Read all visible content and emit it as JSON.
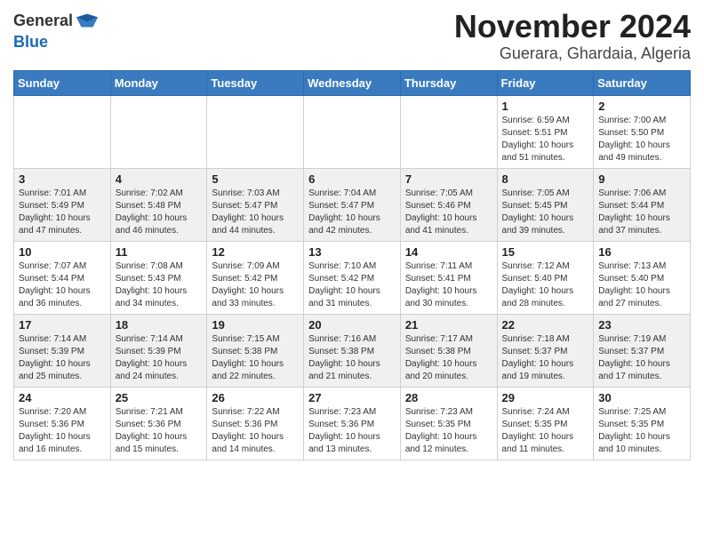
{
  "header": {
    "logo_line1": "General",
    "logo_line2": "Blue",
    "title": "November 2024",
    "subtitle": "Guerara, Ghardaia, Algeria"
  },
  "days_of_week": [
    "Sunday",
    "Monday",
    "Tuesday",
    "Wednesday",
    "Thursday",
    "Friday",
    "Saturday"
  ],
  "weeks": [
    [
      {
        "day": "",
        "info": ""
      },
      {
        "day": "",
        "info": ""
      },
      {
        "day": "",
        "info": ""
      },
      {
        "day": "",
        "info": ""
      },
      {
        "day": "",
        "info": ""
      },
      {
        "day": "1",
        "info": "Sunrise: 6:59 AM\nSunset: 5:51 PM\nDaylight: 10 hours\nand 51 minutes."
      },
      {
        "day": "2",
        "info": "Sunrise: 7:00 AM\nSunset: 5:50 PM\nDaylight: 10 hours\nand 49 minutes."
      }
    ],
    [
      {
        "day": "3",
        "info": "Sunrise: 7:01 AM\nSunset: 5:49 PM\nDaylight: 10 hours\nand 47 minutes."
      },
      {
        "day": "4",
        "info": "Sunrise: 7:02 AM\nSunset: 5:48 PM\nDaylight: 10 hours\nand 46 minutes."
      },
      {
        "day": "5",
        "info": "Sunrise: 7:03 AM\nSunset: 5:47 PM\nDaylight: 10 hours\nand 44 minutes."
      },
      {
        "day": "6",
        "info": "Sunrise: 7:04 AM\nSunset: 5:47 PM\nDaylight: 10 hours\nand 42 minutes."
      },
      {
        "day": "7",
        "info": "Sunrise: 7:05 AM\nSunset: 5:46 PM\nDaylight: 10 hours\nand 41 minutes."
      },
      {
        "day": "8",
        "info": "Sunrise: 7:05 AM\nSunset: 5:45 PM\nDaylight: 10 hours\nand 39 minutes."
      },
      {
        "day": "9",
        "info": "Sunrise: 7:06 AM\nSunset: 5:44 PM\nDaylight: 10 hours\nand 37 minutes."
      }
    ],
    [
      {
        "day": "10",
        "info": "Sunrise: 7:07 AM\nSunset: 5:44 PM\nDaylight: 10 hours\nand 36 minutes."
      },
      {
        "day": "11",
        "info": "Sunrise: 7:08 AM\nSunset: 5:43 PM\nDaylight: 10 hours\nand 34 minutes."
      },
      {
        "day": "12",
        "info": "Sunrise: 7:09 AM\nSunset: 5:42 PM\nDaylight: 10 hours\nand 33 minutes."
      },
      {
        "day": "13",
        "info": "Sunrise: 7:10 AM\nSunset: 5:42 PM\nDaylight: 10 hours\nand 31 minutes."
      },
      {
        "day": "14",
        "info": "Sunrise: 7:11 AM\nSunset: 5:41 PM\nDaylight: 10 hours\nand 30 minutes."
      },
      {
        "day": "15",
        "info": "Sunrise: 7:12 AM\nSunset: 5:40 PM\nDaylight: 10 hours\nand 28 minutes."
      },
      {
        "day": "16",
        "info": "Sunrise: 7:13 AM\nSunset: 5:40 PM\nDaylight: 10 hours\nand 27 minutes."
      }
    ],
    [
      {
        "day": "17",
        "info": "Sunrise: 7:14 AM\nSunset: 5:39 PM\nDaylight: 10 hours\nand 25 minutes."
      },
      {
        "day": "18",
        "info": "Sunrise: 7:14 AM\nSunset: 5:39 PM\nDaylight: 10 hours\nand 24 minutes."
      },
      {
        "day": "19",
        "info": "Sunrise: 7:15 AM\nSunset: 5:38 PM\nDaylight: 10 hours\nand 22 minutes."
      },
      {
        "day": "20",
        "info": "Sunrise: 7:16 AM\nSunset: 5:38 PM\nDaylight: 10 hours\nand 21 minutes."
      },
      {
        "day": "21",
        "info": "Sunrise: 7:17 AM\nSunset: 5:38 PM\nDaylight: 10 hours\nand 20 minutes."
      },
      {
        "day": "22",
        "info": "Sunrise: 7:18 AM\nSunset: 5:37 PM\nDaylight: 10 hours\nand 19 minutes."
      },
      {
        "day": "23",
        "info": "Sunrise: 7:19 AM\nSunset: 5:37 PM\nDaylight: 10 hours\nand 17 minutes."
      }
    ],
    [
      {
        "day": "24",
        "info": "Sunrise: 7:20 AM\nSunset: 5:36 PM\nDaylight: 10 hours\nand 16 minutes."
      },
      {
        "day": "25",
        "info": "Sunrise: 7:21 AM\nSunset: 5:36 PM\nDaylight: 10 hours\nand 15 minutes."
      },
      {
        "day": "26",
        "info": "Sunrise: 7:22 AM\nSunset: 5:36 PM\nDaylight: 10 hours\nand 14 minutes."
      },
      {
        "day": "27",
        "info": "Sunrise: 7:23 AM\nSunset: 5:36 PM\nDaylight: 10 hours\nand 13 minutes."
      },
      {
        "day": "28",
        "info": "Sunrise: 7:23 AM\nSunset: 5:35 PM\nDaylight: 10 hours\nand 12 minutes."
      },
      {
        "day": "29",
        "info": "Sunrise: 7:24 AM\nSunset: 5:35 PM\nDaylight: 10 hours\nand 11 minutes."
      },
      {
        "day": "30",
        "info": "Sunrise: 7:25 AM\nSunset: 5:35 PM\nDaylight: 10 hours\nand 10 minutes."
      }
    ]
  ]
}
